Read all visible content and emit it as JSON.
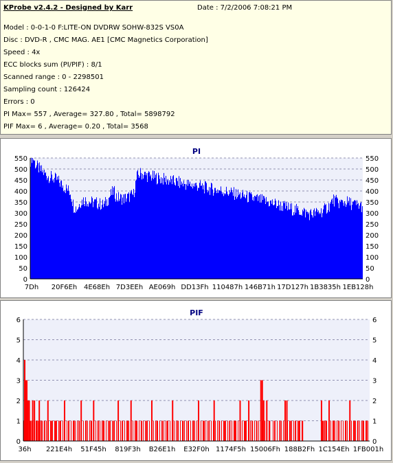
{
  "header": {
    "title": "KProbe v2.4.2 - Designed by Karr",
    "date": "Date : 7/2/2006 7:08:21 PM",
    "lines": [
      "Model : 0-0-1-0 F:LITE-ON DVDRW SOHW-832S  VS0A",
      "Disc : DVD-R , CMC MAG. AE1 [CMC Magnetics Corporation]",
      "Speed : 4x",
      "ECC blocks sum (PI/PIF) : 8/1",
      "Scanned range : 0 - 2298501",
      "Sampling count : 126424",
      "Errors : 0",
      "PI Max= 557 , Average= 327.80 , Total= 5898792",
      "PIF Max= 6 , Average= 0.20 , Total= 3568"
    ]
  },
  "chart_data": [
    {
      "type": "area",
      "title": "PI",
      "ylim": [
        0,
        550
      ],
      "yticks": [
        0,
        50,
        100,
        150,
        200,
        250,
        300,
        350,
        400,
        450,
        500,
        550
      ],
      "xtick_labels": [
        "7Dh",
        "20F6Eh",
        "4E68Eh",
        "7D3EEh",
        "AE069h",
        "DD13Fh",
        "110487h",
        "146B71h",
        "17D127h",
        "1B3835h",
        "1EB128h"
      ],
      "color": "#0000ff",
      "profile": [
        [
          0,
          540
        ],
        [
          0.6,
          560
        ],
        [
          1.5,
          520
        ],
        [
          3,
          495
        ],
        [
          5,
          470
        ],
        [
          8,
          450
        ],
        [
          10,
          420
        ],
        [
          12,
          395
        ],
        [
          13,
          330
        ],
        [
          14,
          320
        ],
        [
          15,
          350
        ],
        [
          16,
          360
        ],
        [
          18,
          350
        ],
        [
          20,
          345
        ],
        [
          22,
          335
        ],
        [
          23,
          355
        ],
        [
          24,
          380
        ],
        [
          25,
          400
        ],
        [
          26,
          370
        ],
        [
          28,
          365
        ],
        [
          30,
          375
        ],
        [
          31,
          385
        ],
        [
          32,
          465
        ],
        [
          33,
          480
        ],
        [
          35,
          470
        ],
        [
          38,
          460
        ],
        [
          41,
          450
        ],
        [
          44,
          440
        ],
        [
          47,
          430
        ],
        [
          50,
          425
        ],
        [
          54,
          410
        ],
        [
          58,
          400
        ],
        [
          62,
          385
        ],
        [
          66,
          370
        ],
        [
          70,
          355
        ],
        [
          74,
          340
        ],
        [
          78,
          320
        ],
        [
          82,
          305
        ],
        [
          84,
          295
        ],
        [
          86,
          300
        ],
        [
          88,
          310
        ],
        [
          90,
          335
        ],
        [
          91,
          360
        ],
        [
          93,
          345
        ],
        [
          95,
          350
        ],
        [
          97,
          340
        ],
        [
          100,
          330
        ]
      ]
    },
    {
      "type": "bar",
      "title": "PIF",
      "ylim": [
        0,
        6
      ],
      "yticks": [
        0,
        1,
        2,
        3,
        4,
        5,
        6
      ],
      "xtick_labels": [
        "36h",
        "221E4h",
        "51F45h",
        "819F3h",
        "B26E1h",
        "E32F0h",
        "1174F5h",
        "15006Fh",
        "188B2Fh",
        "1C154Eh",
        "1FB001h"
      ],
      "color": "#ff0000",
      "spikes": [
        [
          0.3,
          4
        ],
        [
          0.6,
          3
        ],
        [
          0.9,
          3
        ],
        [
          1.2,
          2
        ],
        [
          1.6,
          2
        ],
        [
          2.0,
          1
        ],
        [
          2.6,
          2
        ],
        [
          3.1,
          2
        ],
        [
          3.8,
          1
        ],
        [
          4.5,
          2
        ],
        [
          5.2,
          1
        ],
        [
          6.0,
          1
        ],
        [
          7.0,
          2
        ],
        [
          8.0,
          1
        ],
        [
          9.2,
          1
        ],
        [
          10.5,
          1
        ],
        [
          11.8,
          2
        ],
        [
          13.0,
          1
        ],
        [
          14.5,
          1
        ],
        [
          16.0,
          1
        ],
        [
          16.6,
          2
        ],
        [
          18.0,
          1
        ],
        [
          19.5,
          1
        ],
        [
          20.2,
          2
        ],
        [
          21.5,
          1
        ],
        [
          23.0,
          1
        ],
        [
          24.8,
          1
        ],
        [
          26.0,
          1
        ],
        [
          27.3,
          2
        ],
        [
          28.5,
          1
        ],
        [
          30.0,
          1
        ],
        [
          31.0,
          2
        ],
        [
          32.5,
          1
        ],
        [
          34.0,
          1
        ],
        [
          35.5,
          1
        ],
        [
          37.0,
          2
        ],
        [
          38.5,
          1
        ],
        [
          40.0,
          1
        ],
        [
          41.5,
          1
        ],
        [
          43.0,
          2
        ],
        [
          44.5,
          1
        ],
        [
          46.0,
          1
        ],
        [
          47.5,
          1
        ],
        [
          49.0,
          1
        ],
        [
          50.5,
          2
        ],
        [
          52.0,
          1
        ],
        [
          53.5,
          1
        ],
        [
          55.0,
          2
        ],
        [
          56.5,
          1
        ],
        [
          58.0,
          1
        ],
        [
          59.5,
          1
        ],
        [
          61.0,
          1
        ],
        [
          62.5,
          2
        ],
        [
          64.0,
          1
        ],
        [
          65.0,
          2
        ],
        [
          66.0,
          1
        ],
        [
          67.3,
          1
        ],
        [
          68.5,
          3
        ],
        [
          68.9,
          3
        ],
        [
          69.3,
          2
        ],
        [
          70.2,
          2
        ],
        [
          71.0,
          1
        ],
        [
          72.5,
          1
        ],
        [
          74.0,
          1
        ],
        [
          75.5,
          2
        ],
        [
          76.0,
          2
        ],
        [
          77.0,
          1
        ],
        [
          78.5,
          1
        ],
        [
          79.5,
          1
        ],
        [
          80.5,
          1
        ],
        [
          86.0,
          2
        ],
        [
          86.5,
          1
        ],
        [
          87.3,
          1
        ],
        [
          88.2,
          2
        ],
        [
          89.5,
          1
        ],
        [
          91.0,
          1
        ],
        [
          93.0,
          1
        ],
        [
          94.2,
          2
        ],
        [
          95.5,
          1
        ],
        [
          96.5,
          1
        ],
        [
          98.0,
          1
        ],
        [
          99.0,
          1
        ]
      ]
    }
  ]
}
